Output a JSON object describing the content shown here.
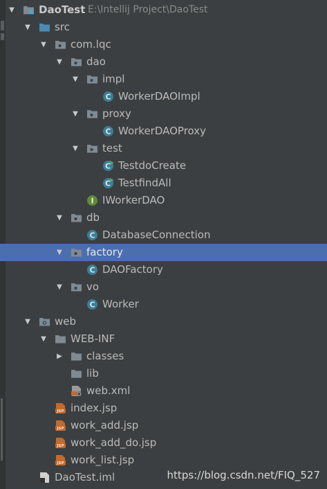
{
  "tree": [
    {
      "id": "daotest",
      "label": "DaoTest",
      "path": "E:\\Intellij Project\\DaoTest",
      "icon": "module-folder-icon",
      "arrow": "expanded",
      "level": 0
    },
    {
      "id": "src",
      "label": "src",
      "icon": "source-folder-icon",
      "arrow": "expanded",
      "level": 1
    },
    {
      "id": "com-lqc",
      "label": "com.lqc",
      "icon": "package-icon",
      "arrow": "expanded",
      "level": 2
    },
    {
      "id": "dao",
      "label": "dao",
      "icon": "package-icon",
      "arrow": "expanded",
      "level": 3
    },
    {
      "id": "impl",
      "label": "impl",
      "icon": "package-icon",
      "arrow": "expanded",
      "level": 4
    },
    {
      "id": "workerdaoimpl",
      "label": "WorkerDAOImpl",
      "icon": "class-icon",
      "arrow": "none",
      "level": 5
    },
    {
      "id": "proxy",
      "label": "proxy",
      "icon": "package-icon",
      "arrow": "expanded",
      "level": 4
    },
    {
      "id": "workerdaoproxy",
      "label": "WorkerDAOProxy",
      "icon": "class-icon",
      "arrow": "none",
      "level": 5
    },
    {
      "id": "test",
      "label": "test",
      "icon": "package-icon",
      "arrow": "expanded",
      "level": 4
    },
    {
      "id": "testdocreate",
      "label": "TestdoCreate",
      "icon": "runnable-class-icon",
      "arrow": "none",
      "level": 5
    },
    {
      "id": "testfindall",
      "label": "TestfindAll",
      "icon": "runnable-class-icon",
      "arrow": "none",
      "level": 5
    },
    {
      "id": "iworkerdao",
      "label": "IWorkerDAO",
      "icon": "interface-icon",
      "arrow": "none",
      "level": 4
    },
    {
      "id": "db",
      "label": "db",
      "icon": "package-icon",
      "arrow": "expanded",
      "level": 3
    },
    {
      "id": "databaseconnection",
      "label": "DatabaseConnection",
      "icon": "class-icon",
      "arrow": "none",
      "level": 4
    },
    {
      "id": "factory",
      "label": "factory",
      "icon": "package-icon",
      "arrow": "expanded",
      "level": 3,
      "selected": true
    },
    {
      "id": "daofactory",
      "label": "DAOFactory",
      "icon": "class-icon",
      "arrow": "none",
      "level": 4
    },
    {
      "id": "vo",
      "label": "vo",
      "icon": "package-icon",
      "arrow": "expanded",
      "level": 3
    },
    {
      "id": "worker",
      "label": "Worker",
      "icon": "class-icon",
      "arrow": "none",
      "level": 4
    },
    {
      "id": "web",
      "label": "web",
      "icon": "web-folder-icon",
      "arrow": "expanded",
      "level": 1
    },
    {
      "id": "web-inf",
      "label": "WEB-INF",
      "icon": "folder-icon",
      "arrow": "expanded",
      "level": 2
    },
    {
      "id": "classes",
      "label": "classes",
      "icon": "folder-icon",
      "arrow": "collapsed",
      "level": 3
    },
    {
      "id": "lib",
      "label": "lib",
      "icon": "folder-icon",
      "arrow": "none",
      "level": 3
    },
    {
      "id": "web-xml",
      "label": "web.xml",
      "icon": "xml-file-icon",
      "arrow": "none",
      "level": 3
    },
    {
      "id": "index-jsp",
      "label": "index.jsp",
      "icon": "jsp-file-icon",
      "arrow": "none",
      "level": 2
    },
    {
      "id": "work-add-jsp",
      "label": "work_add.jsp",
      "icon": "jsp-file-icon",
      "arrow": "none",
      "level": 2
    },
    {
      "id": "work-add-do-jsp",
      "label": "work_add_do.jsp",
      "icon": "jsp-file-icon",
      "arrow": "none",
      "level": 2
    },
    {
      "id": "work-list-jsp",
      "label": "work_list.jsp",
      "icon": "jsp-file-icon",
      "arrow": "none",
      "level": 2
    },
    {
      "id": "daotest-iml",
      "label": "DaoTest.iml",
      "icon": "iml-file-icon",
      "arrow": "none",
      "level": 1
    }
  ],
  "watermark": "https://blog.csdn.net/FIQ_527",
  "colors": {
    "background": "#3c3f41",
    "selection": "#4b6eaf",
    "folder": "#7f8a93",
    "source_folder": "#4a8ab5",
    "class": "#3b7e96",
    "interface": "#5f8a3a",
    "jsp": "#c36a2d"
  }
}
